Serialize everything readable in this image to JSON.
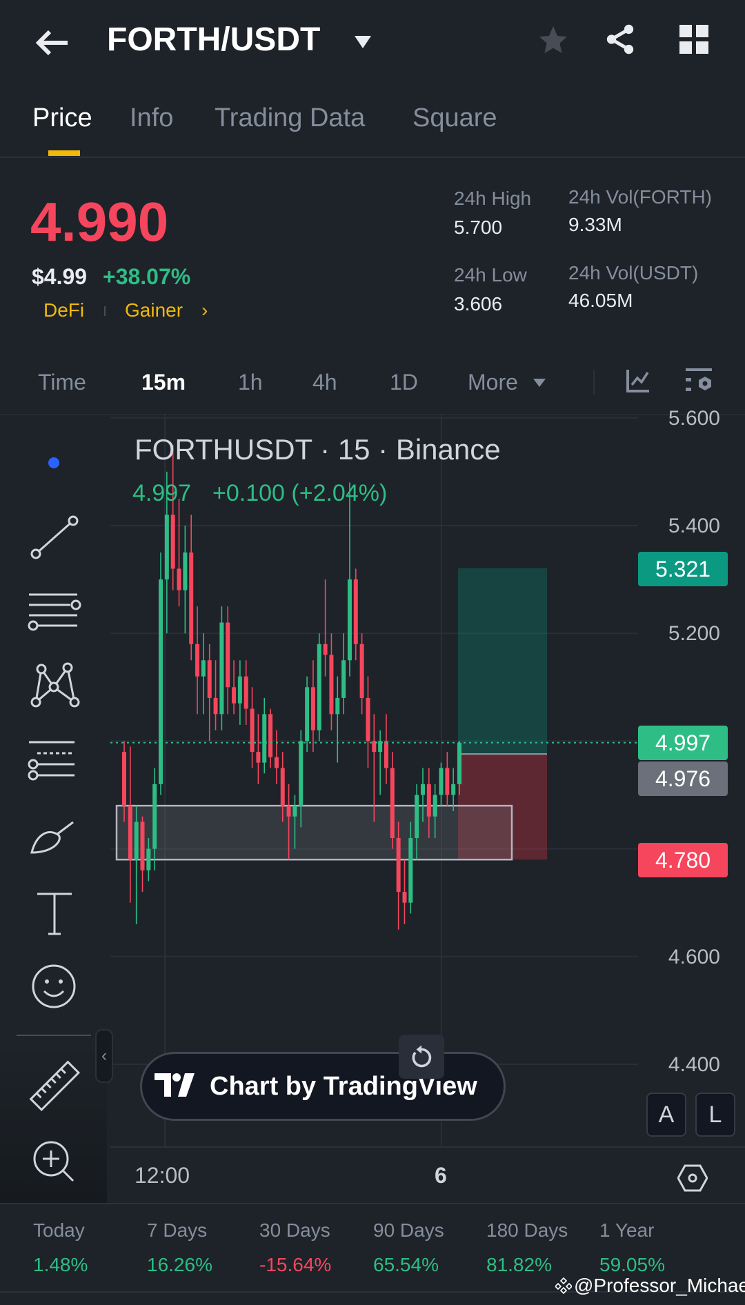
{
  "header": {
    "title": "FORTH/USDT",
    "icons": [
      "back-arrow-icon",
      "dropdown-caret-icon",
      "star-icon",
      "share-icon",
      "grid-icon"
    ]
  },
  "tabs": [
    {
      "label": "Price"
    },
    {
      "label": "Info"
    },
    {
      "label": "Trading Data"
    },
    {
      "label": "Square"
    }
  ],
  "price": {
    "last": "4.990",
    "usd": "$4.99",
    "change": "+38.07%",
    "tag1": "DeFi",
    "tag2": "Gainer"
  },
  "stats": {
    "high_label": "24h High",
    "high": "5.700",
    "low_label": "24h Low",
    "low": "3.606",
    "vol_base_label": "24h Vol(FORTH)",
    "vol_base": "9.33M",
    "vol_quote_label": "24h Vol(USDT)",
    "vol_quote": "46.05M"
  },
  "timeframes": [
    {
      "label": "Time"
    },
    {
      "label": "15m"
    },
    {
      "label": "1h"
    },
    {
      "label": "4h"
    },
    {
      "label": "1D"
    },
    {
      "label": "More"
    }
  ],
  "chart": {
    "legend": "FORTHUSDT · 15 · Binance",
    "ohlc_close": "4.997",
    "ohlc_change": "+0.100 (+2.04%)",
    "x_labels": [
      "12:00",
      "6"
    ],
    "watermark": "Chart by TradingView",
    "scale_a": "A",
    "scale_l": "L",
    "price_tags": {
      "take_profit": "5.321",
      "last": "4.997",
      "entry": "4.976",
      "stop": "4.780"
    }
  },
  "colors": {
    "up": "#2ebd85",
    "down": "#f6465d",
    "accent": "#f0b90b"
  },
  "chart_data": {
    "type": "candlestick",
    "title": "FORTHUSDT · 15 · Binance",
    "ylim": [
      4.4,
      5.6
    ],
    "y_ticks": [
      "5.600",
      "5.400",
      "5.200",
      "4.600",
      "4.400"
    ],
    "candles": [
      [
        4.98,
        5.0,
        4.85,
        4.88
      ],
      [
        4.88,
        4.99,
        4.7,
        4.78
      ],
      [
        4.78,
        4.88,
        4.66,
        4.85
      ],
      [
        4.85,
        4.86,
        4.72,
        4.76
      ],
      [
        4.76,
        4.82,
        4.74,
        4.8
      ],
      [
        4.8,
        4.95,
        4.76,
        4.92
      ],
      [
        4.92,
        5.35,
        4.9,
        5.3
      ],
      [
        5.3,
        5.5,
        5.2,
        5.42
      ],
      [
        5.42,
        5.55,
        5.28,
        5.32
      ],
      [
        5.32,
        5.45,
        5.25,
        5.28
      ],
      [
        5.28,
        5.4,
        5.2,
        5.35
      ],
      [
        5.35,
        5.42,
        5.15,
        5.18
      ],
      [
        5.18,
        5.25,
        5.05,
        5.12
      ],
      [
        5.12,
        5.2,
        5.05,
        5.15
      ],
      [
        5.15,
        5.18,
        5.0,
        5.08
      ],
      [
        5.08,
        5.15,
        5.02,
        5.05
      ],
      [
        5.05,
        5.25,
        5.02,
        5.22
      ],
      [
        5.22,
        5.25,
        5.05,
        5.1
      ],
      [
        5.1,
        5.15,
        5.05,
        5.07
      ],
      [
        5.07,
        5.15,
        5.03,
        5.12
      ],
      [
        5.12,
        5.15,
        5.03,
        5.06
      ],
      [
        5.06,
        5.1,
        4.95,
        4.98
      ],
      [
        4.98,
        5.05,
        4.92,
        4.96
      ],
      [
        4.96,
        5.08,
        4.94,
        5.05
      ],
      [
        5.05,
        5.06,
        4.95,
        4.97
      ],
      [
        4.97,
        5.02,
        4.92,
        4.95
      ],
      [
        4.95,
        4.98,
        4.85,
        4.88
      ],
      [
        4.88,
        4.92,
        4.78,
        4.86
      ],
      [
        4.86,
        4.9,
        4.8,
        4.88
      ],
      [
        4.88,
        5.02,
        4.84,
        5.0
      ],
      [
        5.0,
        5.12,
        4.98,
        5.1
      ],
      [
        5.1,
        5.15,
        4.98,
        5.02
      ],
      [
        5.02,
        5.2,
        5.0,
        5.18
      ],
      [
        5.18,
        5.3,
        5.12,
        5.16
      ],
      [
        5.16,
        5.2,
        5.02,
        5.05
      ],
      [
        5.05,
        5.12,
        4.96,
        5.08
      ],
      [
        5.08,
        5.2,
        5.05,
        5.15
      ],
      [
        5.15,
        5.48,
        5.12,
        5.3
      ],
      [
        5.3,
        5.32,
        5.15,
        5.18
      ],
      [
        5.18,
        5.2,
        5.05,
        5.08
      ],
      [
        5.08,
        5.12,
        4.95,
        5.0
      ],
      [
        5.0,
        5.05,
        4.85,
        4.98
      ],
      [
        4.98,
        5.02,
        4.9,
        5.0
      ],
      [
        5.0,
        5.05,
        4.92,
        4.95
      ],
      [
        4.95,
        4.98,
        4.8,
        4.82
      ],
      [
        4.82,
        4.85,
        4.65,
        4.72
      ],
      [
        4.72,
        4.78,
        4.66,
        4.7
      ],
      [
        4.7,
        4.85,
        4.68,
        4.82
      ],
      [
        4.82,
        4.92,
        4.78,
        4.9
      ],
      [
        4.9,
        4.95,
        4.85,
        4.92
      ],
      [
        4.92,
        4.95,
        4.82,
        4.86
      ],
      [
        4.86,
        4.92,
        4.82,
        4.9
      ],
      [
        4.9,
        4.96,
        4.88,
        4.95
      ],
      [
        4.95,
        4.98,
        4.88,
        4.9
      ],
      [
        4.9,
        4.95,
        4.87,
        4.92
      ],
      [
        4.92,
        5.0,
        4.9,
        4.997
      ]
    ],
    "position": {
      "take_profit": 5.321,
      "entry": 4.976,
      "stop": 4.78
    },
    "zone": [
      4.78,
      4.88
    ],
    "last_price": 4.997
  },
  "performance": [
    {
      "label": "Today",
      "value": "1.48%",
      "dir": "up"
    },
    {
      "label": "7 Days",
      "value": "16.26%",
      "dir": "up"
    },
    {
      "label": "30 Days",
      "value": "-15.64%",
      "dir": "down"
    },
    {
      "label": "90 Days",
      "value": "65.54%",
      "dir": "up"
    },
    {
      "label": "180 Days",
      "value": "81.82%",
      "dir": "up"
    },
    {
      "label": "1 Year",
      "value": "59.05%",
      "dir": "up"
    }
  ],
  "watermark_user": "@Professor_Michael"
}
